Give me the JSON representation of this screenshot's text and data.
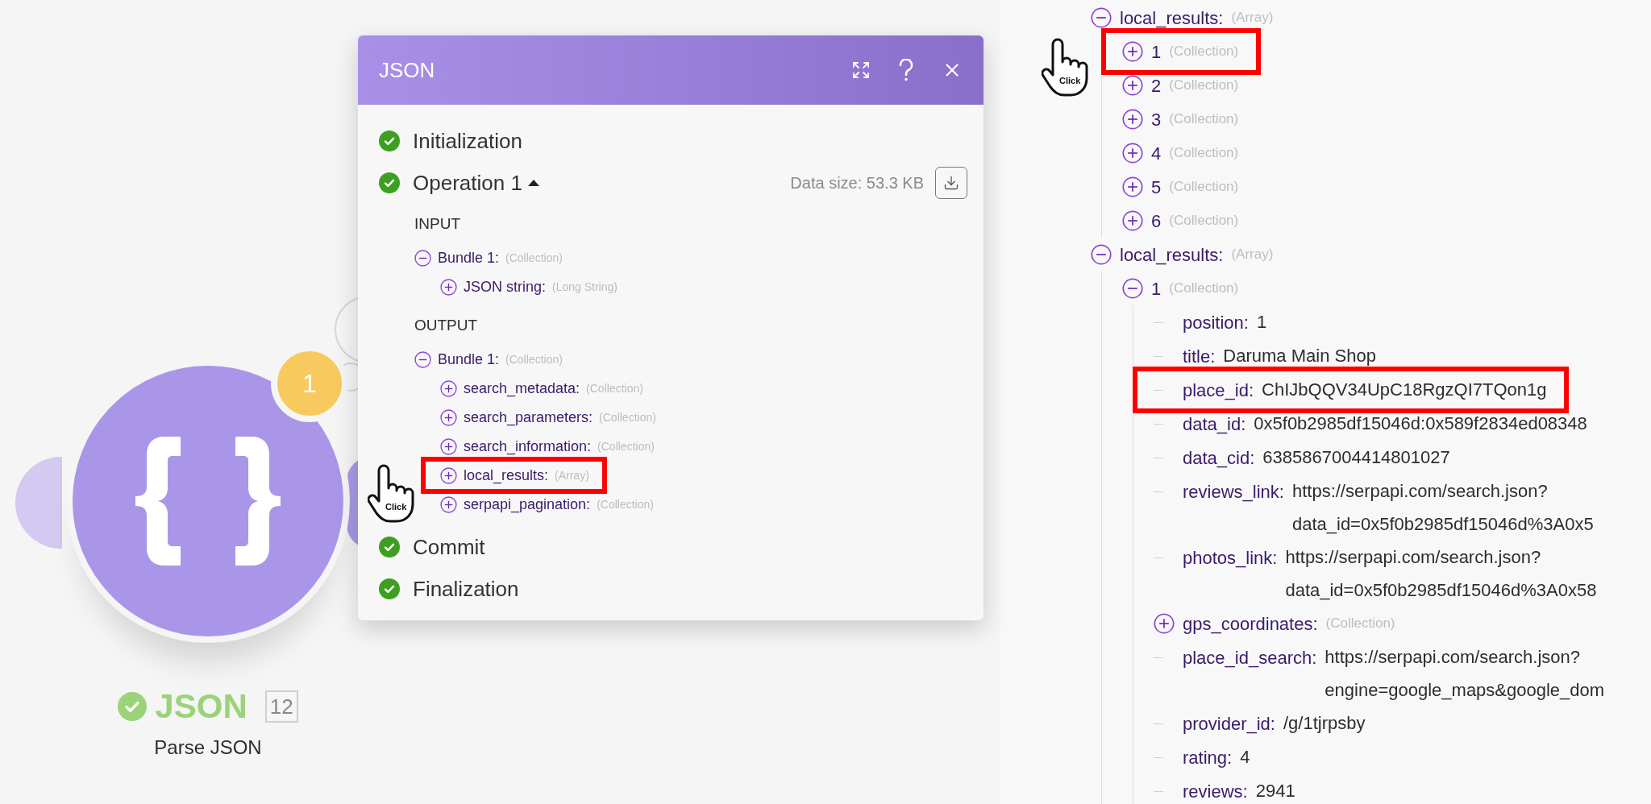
{
  "canvas_node": {
    "badge": "1",
    "title": "JSON",
    "count": "12",
    "subtitle": "Parse JSON"
  },
  "dialog": {
    "title": "JSON",
    "steps": [
      {
        "label": "Initialization"
      },
      {
        "label": "Operation 1",
        "expanded": true,
        "data_size": "Data size: 53.3 KB",
        "sections": [
          {
            "heading": "INPUT",
            "tree": [
              {
                "key": "Bundle 1:",
                "type": "(Collection)",
                "expanded": true,
                "highlighted": false,
                "children": [
                  {
                    "key": "JSON string:",
                    "type": "(Long String)",
                    "expanded": false,
                    "highlighted": false
                  }
                ]
              }
            ]
          },
          {
            "heading": "OUTPUT",
            "tree": [
              {
                "key": "Bundle 1:",
                "type": "(Collection)",
                "expanded": true,
                "highlighted": false,
                "children": [
                  {
                    "key": "search_metadata:",
                    "type": "(Collection)",
                    "expanded": false,
                    "highlighted": false
                  },
                  {
                    "key": "search_parameters:",
                    "type": "(Collection)",
                    "expanded": false,
                    "highlighted": false
                  },
                  {
                    "key": "search_information:",
                    "type": "(Collection)",
                    "expanded": false,
                    "highlighted": false
                  },
                  {
                    "key": "local_results:",
                    "type": "(Array)",
                    "expanded": false,
                    "highlighted": true,
                    "click_hint": "Click"
                  },
                  {
                    "key": "serpapi_pagination:",
                    "type": "(Collection)",
                    "expanded": false,
                    "highlighted": false
                  }
                ]
              }
            ]
          }
        ]
      },
      {
        "label": "Commit"
      },
      {
        "label": "Finalization"
      }
    ]
  },
  "detail_tree": [
    {
      "key": "local_results:",
      "type": "(Array)",
      "expanded": true,
      "highlighted": false,
      "children": [
        {
          "key": "1",
          "type": "(Collection)",
          "expanded": false,
          "highlighted": true,
          "click_hint": "Click"
        },
        {
          "key": "2",
          "type": "(Collection)",
          "expanded": false,
          "highlighted": false
        },
        {
          "key": "3",
          "type": "(Collection)",
          "expanded": false,
          "highlighted": false
        },
        {
          "key": "4",
          "type": "(Collection)",
          "expanded": false,
          "highlighted": false
        },
        {
          "key": "5",
          "type": "(Collection)",
          "expanded": false,
          "highlighted": false
        },
        {
          "key": "6",
          "type": "(Collection)",
          "expanded": false,
          "highlighted": false
        }
      ]
    },
    {
      "key": "local_results:",
      "type": "(Array)",
      "expanded": true,
      "highlighted": false,
      "children": [
        {
          "key": "1",
          "type": "(Collection)",
          "expanded": true,
          "highlighted": false,
          "children": [
            {
              "key": "position:",
              "value_lines": [
                "1"
              ],
              "highlighted": false
            },
            {
              "key": "title:",
              "value_lines": [
                "Daruma Main Shop"
              ],
              "highlighted": false
            },
            {
              "key": "place_id:",
              "value_lines": [
                "ChIJbQQV34UpC18RgzQI7TQon1g"
              ],
              "highlighted": true
            },
            {
              "key": "data_id:",
              "value_lines": [
                "0x5f0b2985df15046d:0x589f2834ed08348"
              ],
              "highlighted": false
            },
            {
              "key": "data_cid:",
              "value_lines": [
                "6385867004414801027"
              ],
              "highlighted": false
            },
            {
              "key": "reviews_link:",
              "value_lines": [
                "https://serpapi.com/search.json?",
                "data_id=0x5f0b2985df15046d%3A0x5"
              ],
              "highlighted": false
            },
            {
              "key": "photos_link:",
              "value_lines": [
                "https://serpapi.com/search.json?",
                "data_id=0x5f0b2985df15046d%3A0x58"
              ],
              "highlighted": false
            },
            {
              "key": "gps_coordinates:",
              "type": "(Collection)",
              "expanded": false,
              "highlighted": false
            },
            {
              "key": "place_id_search:",
              "value_lines": [
                "https://serpapi.com/search.json?",
                "engine=google_maps&google_dom"
              ],
              "highlighted": false
            },
            {
              "key": "provider_id:",
              "value_lines": [
                "/g/1tjrpsby"
              ],
              "highlighted": false
            },
            {
              "key": "rating:",
              "value_lines": [
                "4"
              ],
              "highlighted": false
            },
            {
              "key": "reviews:",
              "value_lines": [
                "2941"
              ],
              "highlighted": false
            }
          ]
        }
      ]
    }
  ]
}
